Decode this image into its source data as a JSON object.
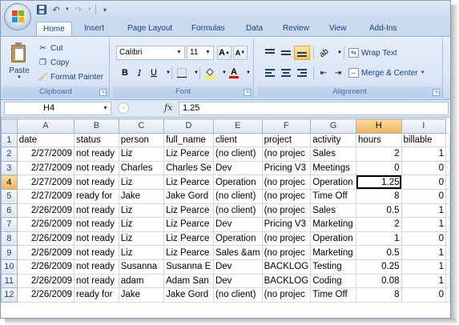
{
  "quick_access": {
    "save_icon": "save-icon",
    "undo_icon": "undo-icon",
    "redo_icon": "redo-icon",
    "customize_icon": "customize-icon"
  },
  "tabs": [
    "Home",
    "Insert",
    "Page Layout",
    "Formulas",
    "Data",
    "Review",
    "View",
    "Add-Ins"
  ],
  "active_tab": "Home",
  "clipboard": {
    "paste_label": "Paste",
    "cut_label": "Cut",
    "copy_label": "Copy",
    "format_painter_label": "Format Painter",
    "group_label": "Clipboard"
  },
  "font": {
    "font_name": "Calibri",
    "font_size": "11",
    "bold": "B",
    "italic": "I",
    "underline": "U",
    "grow_font": "A",
    "shrink_font": "A",
    "font_color_letter": "A",
    "group_label": "Font"
  },
  "alignment": {
    "wrap_text_label": "Wrap Text",
    "merge_center_label": "Merge & Center",
    "group_label": "Alignment"
  },
  "formula_bar": {
    "name_box": "H4",
    "fx_label": "fx",
    "formula_value": "1.25"
  },
  "grid": {
    "column_headers": [
      "A",
      "B",
      "C",
      "D",
      "E",
      "F",
      "G",
      "H",
      "I"
    ],
    "selected_column": "H",
    "selected_row": "4",
    "rows": [
      {
        "num": "1",
        "cells": [
          "date",
          "status",
          "person",
          "full_name",
          "client",
          "project",
          "activity",
          "hours",
          "billable"
        ]
      },
      {
        "num": "2",
        "cells": [
          "2/27/2009",
          "not ready",
          "Liz",
          "Liz Pearce",
          "(no client)",
          "(no projec",
          "Sales",
          "2",
          "1"
        ]
      },
      {
        "num": "3",
        "cells": [
          "2/27/2009",
          "not ready",
          "Charles",
          "Charles Se",
          "Dev",
          "Pricing V3",
          "Meetings",
          "0",
          "0"
        ]
      },
      {
        "num": "4",
        "cells": [
          "2/27/2009",
          "not ready",
          "Liz",
          "Liz Pearce",
          "Operation",
          "(no projec",
          "Operation",
          "1.25",
          "0"
        ]
      },
      {
        "num": "5",
        "cells": [
          "2/27/2009",
          "ready for",
          "Jake",
          "Jake Gord",
          "(no client)",
          "(no projec",
          "Time Off",
          "8",
          "0"
        ]
      },
      {
        "num": "6",
        "cells": [
          "2/26/2009",
          "not ready",
          "Liz",
          "Liz Pearce",
          "(no client)",
          "(no projec",
          "Sales",
          "0.5",
          "1"
        ]
      },
      {
        "num": "7",
        "cells": [
          "2/26/2009",
          "not ready",
          "Liz",
          "Liz Pearce",
          "Dev",
          "Pricing V3",
          "Marketing",
          "2",
          "1"
        ]
      },
      {
        "num": "8",
        "cells": [
          "2/26/2009",
          "not ready",
          "Liz",
          "Liz Pearce",
          "Operation",
          "(no projec",
          "Operation",
          "1",
          "0"
        ]
      },
      {
        "num": "9",
        "cells": [
          "2/26/2009",
          "not ready",
          "Liz",
          "Liz Pearce",
          "Sales &am",
          "(no projec",
          "Marketing",
          "0.5",
          "1"
        ]
      },
      {
        "num": "10",
        "cells": [
          "2/26/2009",
          "not ready",
          "Susanna",
          "Susanna E",
          "Dev",
          "BACKLOG",
          "Testing",
          "0.25",
          "1"
        ]
      },
      {
        "num": "11",
        "cells": [
          "2/26/2009",
          "not ready",
          "adam",
          "Adam San",
          "Dev",
          "BACKLOG",
          "Coding",
          "0.08",
          "1"
        ]
      },
      {
        "num": "12",
        "cells": [
          "2/26/2009",
          "ready for",
          "Jake",
          "Jake Gord",
          "(no client)",
          "(no projec",
          "Time Off",
          "8",
          "0"
        ]
      }
    ]
  },
  "colors": {
    "ribbon_bg": "#dae6f5",
    "selection_header": "#f1b659",
    "grid_line": "#d0d7e5",
    "text_blue": "#15428b"
  }
}
